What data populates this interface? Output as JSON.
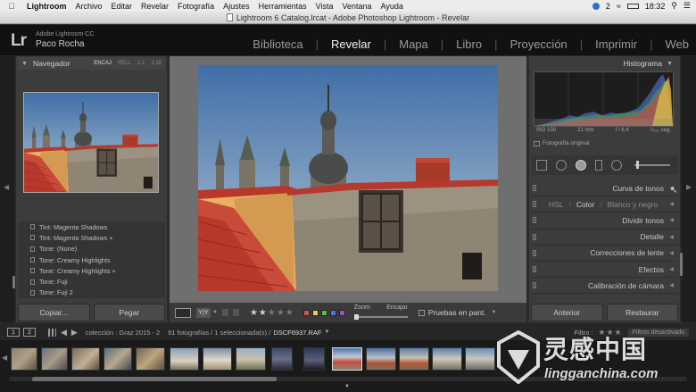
{
  "menubar": {
    "apple_icon": "apple-icon",
    "items": [
      "Lightroom",
      "Archivo",
      "Editar",
      "Revelar",
      "Fotografía",
      "Ajustes",
      "Herramientas",
      "Vista",
      "Ventana",
      "Ayuda"
    ],
    "status_number": "2",
    "clock": "18:32"
  },
  "window": {
    "title": "Lightroom 6 Catalog.lrcat - Adobe Photoshop Lightroom - Revelar"
  },
  "identity": {
    "logo": "Lr",
    "app_name": "Adobe Lightroom CC",
    "user_name": "Paco Rocha"
  },
  "modules": [
    "Biblioteca",
    "Revelar",
    "Mapa",
    "Libro",
    "Proyección",
    "Imprimir",
    "Web"
  ],
  "navigator": {
    "title": "Navegador",
    "options": [
      "ENCAJ",
      "RELL",
      "1:1",
      "1:16"
    ]
  },
  "presets": [
    "Tint: Magenta Shadows",
    "Tint: Magenta Shadows +",
    "Tone: (None)",
    "Tone: Creamy Highlights",
    "Tone: Creamy Highlights +",
    "Tone: Fuji",
    "Tone: Fuji 2"
  ],
  "left_buttons": {
    "copy": "Copiar...",
    "paste": "Pegar"
  },
  "toolbar": {
    "yy_label": "Y|Y",
    "zoom_label": "Zoom",
    "fit_label": "Encajar",
    "proof_label": "Pruebas en pant."
  },
  "histogram": {
    "title": "Histograma",
    "iso": "ISO 100",
    "focal": "21 mm",
    "aperture": "f / 6,4",
    "shutter": "¹⁄₃₂₀ seg.",
    "original_photo": "Fotografía original"
  },
  "develop_panels": {
    "tone_curve": "Curva de tonos",
    "hsl": "HSL",
    "color": "Color",
    "bw": "Blanco y negro",
    "split_toning": "Dividir tonos",
    "detail": "Detalle",
    "lens_corrections": "Correcciones de lente",
    "effects": "Efectos",
    "camera_calibration": "Calibración de cámara"
  },
  "right_buttons": {
    "previous": "Anterior",
    "reset": "Restaurar"
  },
  "filmstrip_bar": {
    "monitor1": "1",
    "monitor2": "2",
    "collection": "colección : Graz 2015 - 2",
    "count": "61 fotografías / 1 seleccionada(s) /",
    "filename": "DSCF6937.RAF",
    "filter_label": "Filtro :",
    "filter_status": "Filtros desactivado"
  },
  "watermark": {
    "cn": "灵感中国",
    "en": "lingganchina.com"
  },
  "colors": {
    "accent": "#f2f2f2",
    "panel": "#3c3c3c",
    "center_bg": "#6f6f6f",
    "roof_red": "#b8392c"
  }
}
